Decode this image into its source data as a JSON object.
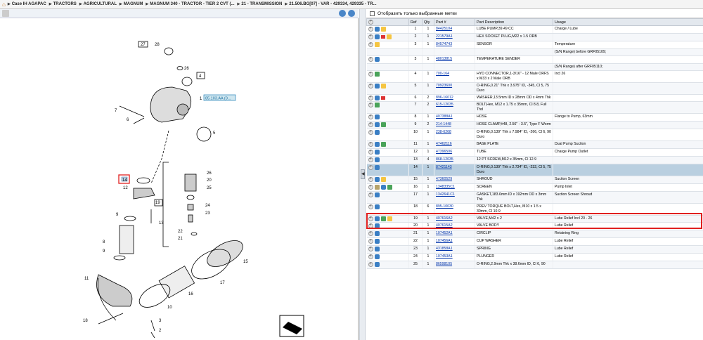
{
  "breadcrumb": {
    "home_icon": "home-icon",
    "items": [
      "Case IH AGAPAC",
      "TRACTORS",
      "AGRICULTURAL",
      "MAGNUM",
      "MAGNUM 340 - TRACTOR - TIER 2 CVT (...",
      "21 - TRANSMISSION",
      "21.506.BG[07] - VAR - 429334, 429335 - TR..."
    ]
  },
  "filter": {
    "label": "Отобразить только выбранные метки"
  },
  "table": {
    "headers": [
      "",
      "Ref",
      "Qty",
      "Part #",
      "Part Description",
      "Usage"
    ],
    "rows": [
      {
        "ref": "1",
        "qty": "1",
        "part": "84425104",
        "desc": "LUBE PUMP,39.49 CC",
        "usage": "Charge / Lube"
      },
      {
        "ref": "2",
        "qty": "1",
        "part": "221579A1",
        "desc": "HEX SOCKET PLUG,M22 x 1.5 ORB",
        "usage": ""
      },
      {
        "ref": "3",
        "qty": "1",
        "part": "84574743",
        "desc": "SENSOR",
        "usage": "Temperature"
      },
      {
        "ref": "",
        "qty": "",
        "part": "",
        "desc": "",
        "usage": "(S/N Range) before GRF05109;"
      },
      {
        "ref": "3",
        "qty": "1",
        "part": "48013815",
        "desc": "TEMPERATURE SENDER",
        "usage": ""
      },
      {
        "ref": "",
        "qty": "",
        "part": "",
        "desc": "",
        "usage": "(S/N Range) after GRF05110;"
      },
      {
        "ref": "4",
        "qty": "1",
        "part": "700-164",
        "desc": "HYD CONNECTOR,1-3/16\" - 12 Male ORFS x M33 x 2 Male ORB",
        "usage": "Incl 26"
      },
      {
        "ref": "5",
        "qty": "1",
        "part": "70923600",
        "desc": "O-RING,0.21\" Thk x 3.975\" ID, -345, Cl 5, 75 Duro",
        "usage": ""
      },
      {
        "ref": "6",
        "qty": "2",
        "part": "896-16012",
        "desc": "WASHER,13.5mm ID x 28mm OD x 4mm Thk",
        "usage": ""
      },
      {
        "ref": "7",
        "qty": "2",
        "part": "615-12035",
        "desc": "BOLT,Hex, M12 x 1.75 x 35mm, Cl 8.8, Full Thd",
        "usage": ""
      },
      {
        "ref": "8",
        "qty": "1",
        "part": "407388A1",
        "desc": "HOSE",
        "usage": "Flange to Pump, 63mm"
      },
      {
        "ref": "9",
        "qty": "2",
        "part": "214-1448",
        "desc": "HOSE CLAMP,#48, 2.56\" - 3.5\", Type F Worm",
        "usage": ""
      },
      {
        "ref": "10",
        "qty": "1",
        "part": "238-6268",
        "desc": "O-RING,0.139\" Thk x 7.984\" ID, -266, Cl 6, 90 Duro",
        "usage": ""
      },
      {
        "ref": "11",
        "qty": "1",
        "part": "47462116",
        "desc": "BASE PLATE",
        "usage": "Dual Pump Suction"
      },
      {
        "ref": "12",
        "qty": "1",
        "part": "47396506",
        "desc": "TUBE",
        "usage": "Charge Pump Outlet"
      },
      {
        "ref": "13",
        "qty": "4",
        "part": "868-12035",
        "desc": "12 PT SCREW,M12 x 35mm, Cl 12.9",
        "usage": ""
      },
      {
        "ref": "14",
        "qty": "1",
        "part": "87421143",
        "desc": "O-RING,0.139\" Thk x 2.734\" ID, -232, Cl 5, 75 Duro",
        "usage": ""
      },
      {
        "ref": "15",
        "qty": "1",
        "part": "47360529",
        "desc": "SHROUD",
        "usage": "Suction Screen"
      },
      {
        "ref": "16",
        "qty": "1",
        "part": "1348335C1",
        "desc": "SCREEN",
        "usage": "Pump Inlet"
      },
      {
        "ref": "17",
        "qty": "1",
        "part": "1342641C1",
        "desc": "GASKET,183.6mm ID x 192mm OD x 3mm Thk",
        "usage": "Suction Screen Shroud"
      },
      {
        "ref": "18",
        "qty": "6",
        "part": "895-10030",
        "desc": "PREV TORQUE BOLT,Hex, M10 x 1.5 x 30mm, Cl 10.9",
        "usage": ""
      },
      {
        "ref": "19",
        "qty": "1",
        "part": "407616A2",
        "desc": "VALVE,M42 x 2",
        "usage": "Lube Relief Incl 20 - 26"
      },
      {
        "ref": "20",
        "qty": "1",
        "part": "407615A2",
        "desc": "VALVE BODY",
        "usage": "Lube Relief"
      },
      {
        "ref": "21",
        "qty": "1",
        "part": "107452A1",
        "desc": "CIRCLIP",
        "usage": "Retaining Ring"
      },
      {
        "ref": "22",
        "qty": "1",
        "part": "107456A1",
        "desc": "CUP WASHER",
        "usage": "Lube Relief"
      },
      {
        "ref": "23",
        "qty": "1",
        "part": "431858A1",
        "desc": "SPRING",
        "usage": "Lube Relief"
      },
      {
        "ref": "24",
        "qty": "1",
        "part": "107453A1",
        "desc": "PLUNGER",
        "usage": "Lube Relief"
      },
      {
        "ref": "25",
        "qty": "1",
        "part": "86598105",
        "desc": "O-RING,2.9mm Thk x 38.6mm ID, Cl 6, 90",
        "usage": ""
      }
    ]
  },
  "diagram": {
    "callouts": [
      "27",
      "28",
      "26",
      "4",
      "1",
      "7",
      "6",
      "5",
      "26",
      "20",
      "25",
      "24",
      "23",
      "22",
      "21",
      "14",
      "12",
      "19",
      "13",
      "9",
      "8",
      "9",
      "15",
      "11",
      "16",
      "17",
      "10",
      "18",
      "3",
      "2"
    ],
    "label_box": "85.103.AA (0..."
  }
}
